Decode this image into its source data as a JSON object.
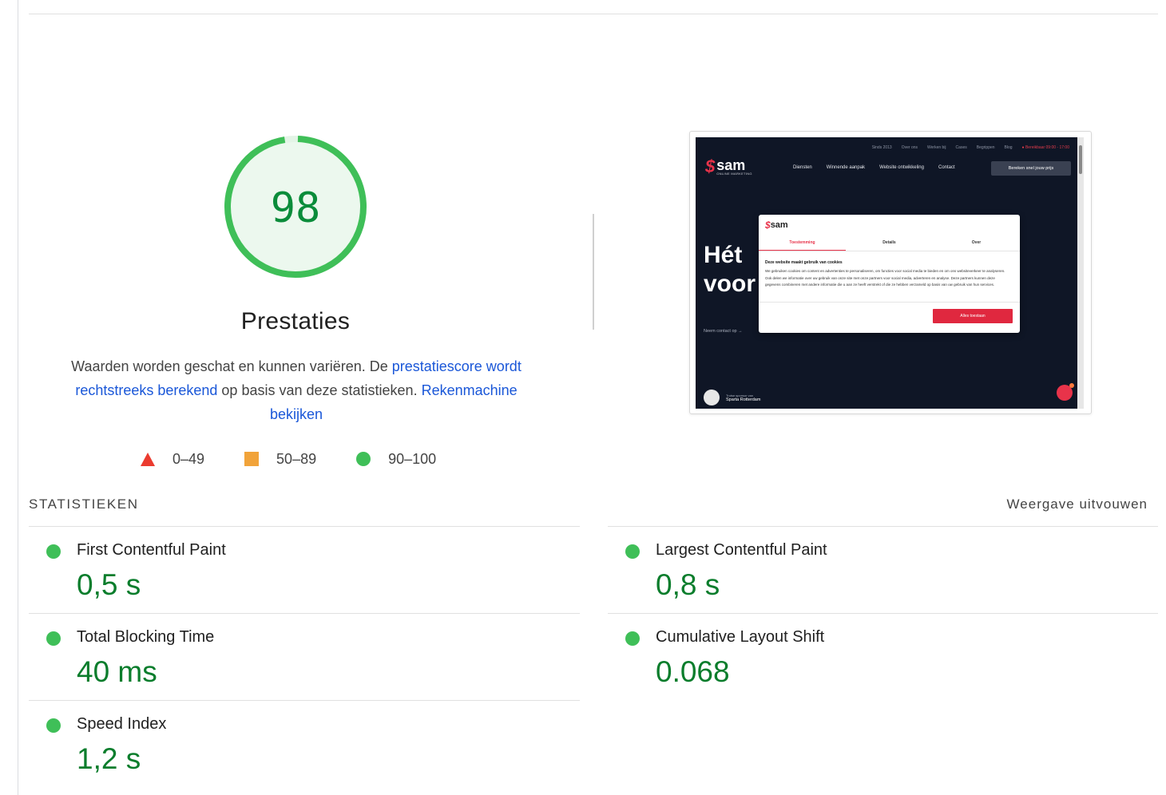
{
  "score": {
    "value": "98",
    "fraction": 0.98,
    "color": "#3fbf58",
    "fill": "#ecf8ee",
    "text_color": "#0a8c3a"
  },
  "category": {
    "title": "Prestaties"
  },
  "description": {
    "text1": "Waarden worden geschat en kunnen variëren. De ",
    "link1": "prestatiescore wordt rechtstreeks berekend",
    "text2": " op basis van deze statistieken. ",
    "link2": "Rekenmachine bekijken"
  },
  "legend": {
    "fail": "0–49",
    "average": "50–89",
    "pass": "90–100"
  },
  "thumbnail": {
    "util_items": [
      "Sinds 2013",
      "Over ons",
      "Werken bij",
      "Cases",
      "Begrippen",
      "Blog"
    ],
    "util_live": "● Bereikbaar 09:00 - 17:00",
    "logo_word": "sam",
    "logo_sub": "ONLINE MARKETING",
    "nav_items": [
      "Diensten",
      "Winnende aanpak",
      "Website ontwikkeling",
      "Contact"
    ],
    "cta": "Bereken snel jouw prijs",
    "hero_line1": "Hét",
    "hero_line2": "voor",
    "contact": "Neem contact op  →",
    "sponsor_small": "Trotse sponsor van",
    "sponsor": "Sparta Rotterdam",
    "modal": {
      "tabs": [
        "Toestemming",
        "Details",
        "Over"
      ],
      "heading": "Deze website maakt gebruik van cookies",
      "body": "We gebruiken cookies om content en advertenties te personaliseren, om functies voor social media te bieden en om ons websiteverkeer te analyseren. Ook delen we informatie over uw gebruik van onze site met onze partners voor social media, adverteren en analyse. Deze partners kunnen deze gegevens combineren met andere informatie die u aan ze heeft verstrekt of die ze hebben verzameld op basis van uw gebruik van hun services.",
      "button": "Alles toestaan"
    }
  },
  "metrics": {
    "header": "STATISTIEKEN",
    "expand": "Weergave uitvouwen",
    "items": [
      {
        "title": "First Contentful Paint",
        "value": "0,5 s"
      },
      {
        "title": "Largest Contentful Paint",
        "value": "0,8 s"
      },
      {
        "title": "Total Blocking Time",
        "value": "40 ms"
      },
      {
        "title": "Cumulative Layout Shift",
        "value": "0.068"
      },
      {
        "title": "Speed Index",
        "value": "1,2 s"
      }
    ]
  }
}
